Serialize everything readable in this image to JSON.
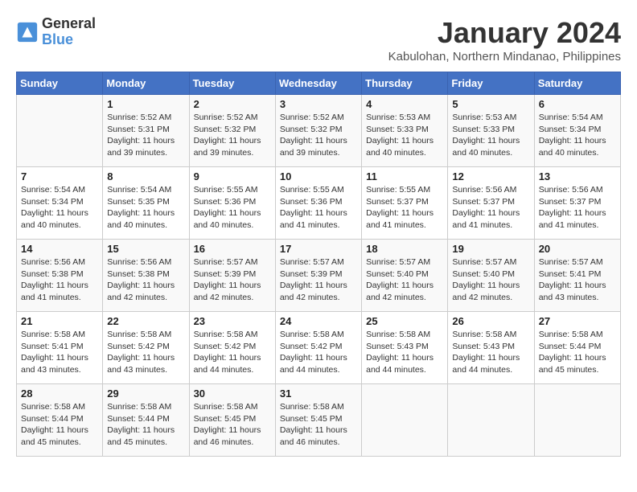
{
  "header": {
    "logo_line1": "General",
    "logo_line2": "Blue",
    "month": "January 2024",
    "location": "Kabulohan, Northern Mindanao, Philippines"
  },
  "weekdays": [
    "Sunday",
    "Monday",
    "Tuesday",
    "Wednesday",
    "Thursday",
    "Friday",
    "Saturday"
  ],
  "weeks": [
    [
      {
        "day": "",
        "info": ""
      },
      {
        "day": "1",
        "info": "Sunrise: 5:52 AM\nSunset: 5:31 PM\nDaylight: 11 hours\nand 39 minutes."
      },
      {
        "day": "2",
        "info": "Sunrise: 5:52 AM\nSunset: 5:32 PM\nDaylight: 11 hours\nand 39 minutes."
      },
      {
        "day": "3",
        "info": "Sunrise: 5:52 AM\nSunset: 5:32 PM\nDaylight: 11 hours\nand 39 minutes."
      },
      {
        "day": "4",
        "info": "Sunrise: 5:53 AM\nSunset: 5:33 PM\nDaylight: 11 hours\nand 40 minutes."
      },
      {
        "day": "5",
        "info": "Sunrise: 5:53 AM\nSunset: 5:33 PM\nDaylight: 11 hours\nand 40 minutes."
      },
      {
        "day": "6",
        "info": "Sunrise: 5:54 AM\nSunset: 5:34 PM\nDaylight: 11 hours\nand 40 minutes."
      }
    ],
    [
      {
        "day": "7",
        "info": "Sunrise: 5:54 AM\nSunset: 5:34 PM\nDaylight: 11 hours\nand 40 minutes."
      },
      {
        "day": "8",
        "info": "Sunrise: 5:54 AM\nSunset: 5:35 PM\nDaylight: 11 hours\nand 40 minutes."
      },
      {
        "day": "9",
        "info": "Sunrise: 5:55 AM\nSunset: 5:36 PM\nDaylight: 11 hours\nand 40 minutes."
      },
      {
        "day": "10",
        "info": "Sunrise: 5:55 AM\nSunset: 5:36 PM\nDaylight: 11 hours\nand 41 minutes."
      },
      {
        "day": "11",
        "info": "Sunrise: 5:55 AM\nSunset: 5:37 PM\nDaylight: 11 hours\nand 41 minutes."
      },
      {
        "day": "12",
        "info": "Sunrise: 5:56 AM\nSunset: 5:37 PM\nDaylight: 11 hours\nand 41 minutes."
      },
      {
        "day": "13",
        "info": "Sunrise: 5:56 AM\nSunset: 5:37 PM\nDaylight: 11 hours\nand 41 minutes."
      }
    ],
    [
      {
        "day": "14",
        "info": "Sunrise: 5:56 AM\nSunset: 5:38 PM\nDaylight: 11 hours\nand 41 minutes."
      },
      {
        "day": "15",
        "info": "Sunrise: 5:56 AM\nSunset: 5:38 PM\nDaylight: 11 hours\nand 42 minutes."
      },
      {
        "day": "16",
        "info": "Sunrise: 5:57 AM\nSunset: 5:39 PM\nDaylight: 11 hours\nand 42 minutes."
      },
      {
        "day": "17",
        "info": "Sunrise: 5:57 AM\nSunset: 5:39 PM\nDaylight: 11 hours\nand 42 minutes."
      },
      {
        "day": "18",
        "info": "Sunrise: 5:57 AM\nSunset: 5:40 PM\nDaylight: 11 hours\nand 42 minutes."
      },
      {
        "day": "19",
        "info": "Sunrise: 5:57 AM\nSunset: 5:40 PM\nDaylight: 11 hours\nand 42 minutes."
      },
      {
        "day": "20",
        "info": "Sunrise: 5:57 AM\nSunset: 5:41 PM\nDaylight: 11 hours\nand 43 minutes."
      }
    ],
    [
      {
        "day": "21",
        "info": "Sunrise: 5:58 AM\nSunset: 5:41 PM\nDaylight: 11 hours\nand 43 minutes."
      },
      {
        "day": "22",
        "info": "Sunrise: 5:58 AM\nSunset: 5:42 PM\nDaylight: 11 hours\nand 43 minutes."
      },
      {
        "day": "23",
        "info": "Sunrise: 5:58 AM\nSunset: 5:42 PM\nDaylight: 11 hours\nand 44 minutes."
      },
      {
        "day": "24",
        "info": "Sunrise: 5:58 AM\nSunset: 5:42 PM\nDaylight: 11 hours\nand 44 minutes."
      },
      {
        "day": "25",
        "info": "Sunrise: 5:58 AM\nSunset: 5:43 PM\nDaylight: 11 hours\nand 44 minutes."
      },
      {
        "day": "26",
        "info": "Sunrise: 5:58 AM\nSunset: 5:43 PM\nDaylight: 11 hours\nand 44 minutes."
      },
      {
        "day": "27",
        "info": "Sunrise: 5:58 AM\nSunset: 5:44 PM\nDaylight: 11 hours\nand 45 minutes."
      }
    ],
    [
      {
        "day": "28",
        "info": "Sunrise: 5:58 AM\nSunset: 5:44 PM\nDaylight: 11 hours\nand 45 minutes."
      },
      {
        "day": "29",
        "info": "Sunrise: 5:58 AM\nSunset: 5:44 PM\nDaylight: 11 hours\nand 45 minutes."
      },
      {
        "day": "30",
        "info": "Sunrise: 5:58 AM\nSunset: 5:45 PM\nDaylight: 11 hours\nand 46 minutes."
      },
      {
        "day": "31",
        "info": "Sunrise: 5:58 AM\nSunset: 5:45 PM\nDaylight: 11 hours\nand 46 minutes."
      },
      {
        "day": "",
        "info": ""
      },
      {
        "day": "",
        "info": ""
      },
      {
        "day": "",
        "info": ""
      }
    ]
  ]
}
